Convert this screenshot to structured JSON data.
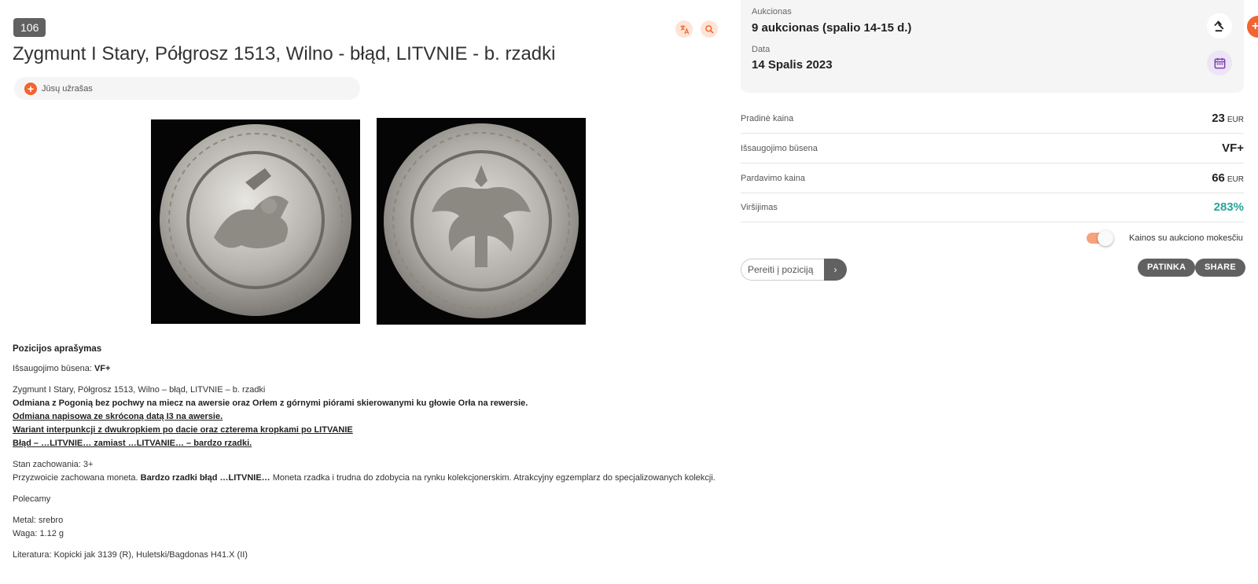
{
  "lot": {
    "number": "106",
    "title": "Zygmunt I Stary, Półgrosz 1513, Wilno - błąd, LITVNIE - b. rzadki"
  },
  "icons": {
    "translate": "translate-icon",
    "search": "search-icon",
    "add": "plus-icon",
    "gavel": "gavel-icon",
    "calendar": "calendar-icon",
    "arrow": "chevron-right-icon"
  },
  "note": {
    "label": "Jūsų užrašas"
  },
  "images": {
    "obverse": "coin-obverse",
    "reverse": "coin-reverse"
  },
  "description": {
    "heading": "Pozicijos aprašymas",
    "condition_label": "Išsaugojimo būsena:",
    "condition_value": "VF+",
    "line_title": "Zygmunt I Stary, Półgrosz 1513, Wilno – błąd, LITVNIE – b. rzadki",
    "line_bold": "Odmiana z Pogonią bez pochwy na miecz na awersie oraz Orłem z górnymi piórami skierowanymi ku głowie Orła na rewersie.",
    "line_u1": "Odmiana napisowa ze skróconą datą I3 na awersie.",
    "line_u2": "Wariant interpunkcji z dwukropkiem po dacie oraz czterema kropkami po LITVANIE",
    "line_u3": "Błąd – …LITVNIE… zamiast …LITVANIE… – bardzo rzadki.",
    "stan": "Stan zachowania: 3+",
    "para_start": "Przyzwoicie zachowana moneta.",
    "para_bold": "Bardzo rzadki błąd …LITVNIE…",
    "para_end": "Moneta rzadka i trudna do zdobycia na rynku kolekcjonerskim. Atrakcyjny egzemplarz do specjalizowanych kolekcji.",
    "polecamy": "Polecamy",
    "metal": "Metal: srebro",
    "waga": "Waga: 1.12 g",
    "literatura": "Literatura: Kopicki jak 3139 (R), Huletski/Bagdonas H41.X (II)"
  },
  "auction": {
    "auction_label": "Aukcionas",
    "auction_value": "9 aukcionas (spalio 14-15 d.)",
    "date_label": "Data",
    "date_value": "14 Spalis 2023"
  },
  "prices": [
    {
      "label": "Pradinė kaina",
      "value": "23",
      "currency": "EUR"
    },
    {
      "label": "Išsaugojimo būsena",
      "value": "VF+",
      "currency": ""
    },
    {
      "label": "Pardavimo kaina",
      "value": "66",
      "currency": "EUR"
    },
    {
      "label": "Viršijimas",
      "value": "283%",
      "currency": ""
    }
  ],
  "toggle": {
    "label": "Kainos su aukciono mokesčiu",
    "on": true
  },
  "goto": {
    "placeholder": "Pereiti į poziciją",
    "button": "›"
  },
  "buttons": {
    "like": "PATINKA",
    "share": "SHARE"
  },
  "colors": {
    "accent": "#f26430",
    "badge": "#616161",
    "green": "#26a69a",
    "card": "#f5f5f5"
  }
}
